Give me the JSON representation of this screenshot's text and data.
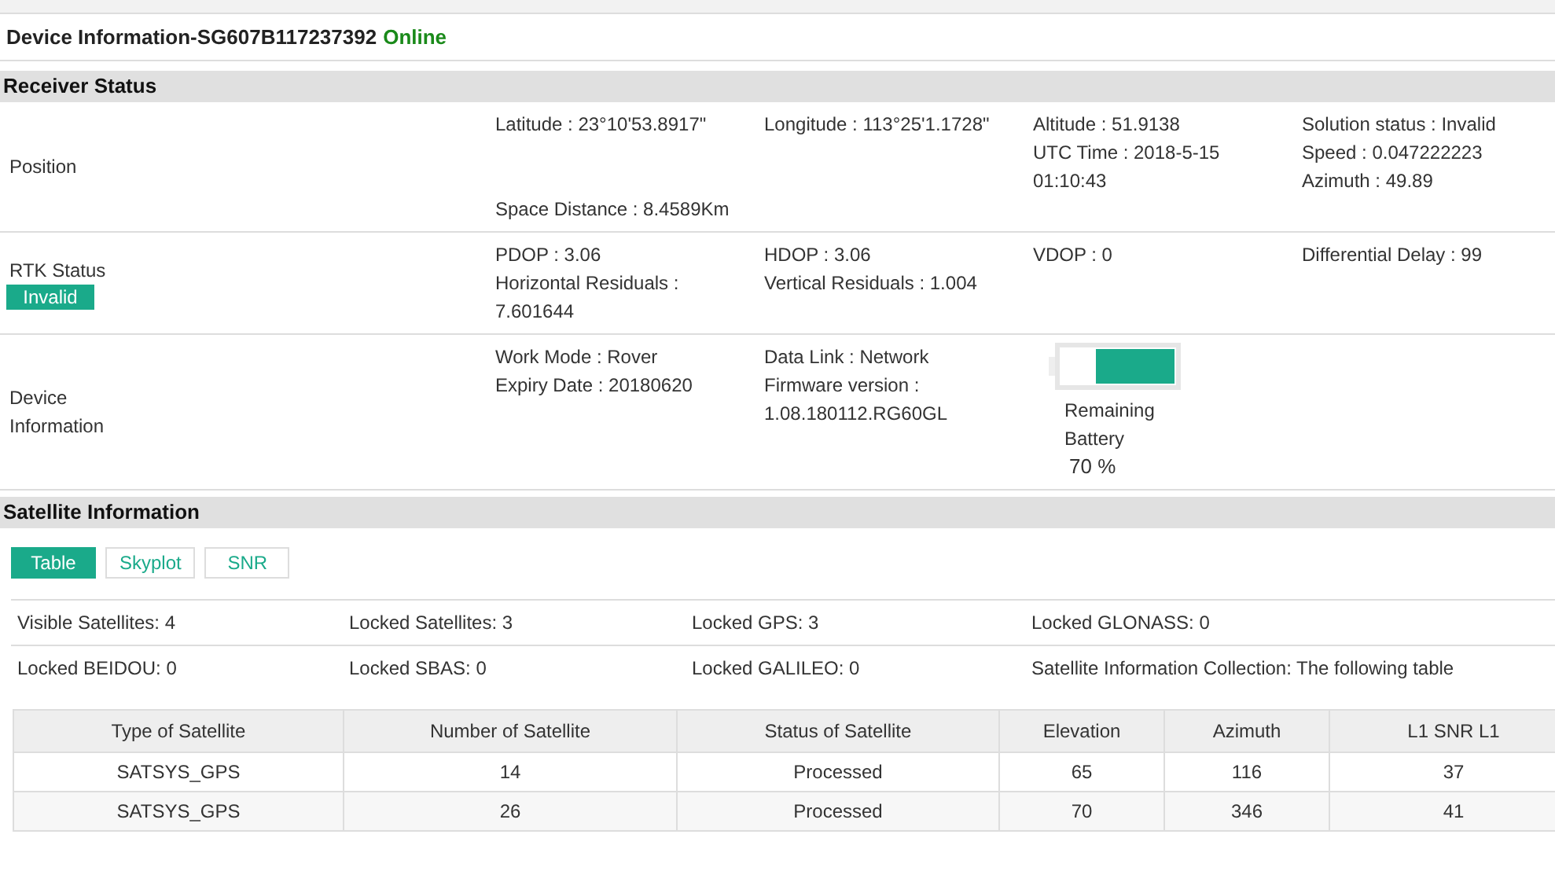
{
  "header": {
    "title": "Device Information-SG607B117237392",
    "status": "Online"
  },
  "receiver_status": {
    "title": "Receiver Status",
    "rows": [
      {
        "label": "Position",
        "cells": [
          [
            "Latitude : 23°10'53.8917\""
          ],
          [
            "Longitude : 113°25'1.1728\""
          ],
          [
            "Altitude : 51.9138",
            "UTC Time : 2018-5-15 01:10:43"
          ],
          [
            "Solution status : Invalid",
            "Speed : 0.047222223",
            "Azimuth : 49.89"
          ],
          [
            "Space Distance : 8.4589Km"
          ]
        ]
      },
      {
        "label": "RTK Status",
        "badge": "Invalid",
        "cells": [
          [
            "PDOP : 3.06",
            "Horizontal Residuals : 7.601644"
          ],
          [
            "HDOP : 3.06",
            "Vertical Residuals : 1.004"
          ],
          [
            "VDOP : 0"
          ],
          [
            "Differential Delay : 99"
          ]
        ]
      },
      {
        "label": "Device Information",
        "cells": [
          [
            "Work Mode : Rover",
            "Expiry Date : 20180620"
          ],
          [
            "Data Link : Network",
            "Firmware version : 1.08.180112.RG60GL"
          ]
        ],
        "battery": {
          "level": 0.7,
          "label": "Remaining Battery",
          "reading": "70 %"
        }
      }
    ]
  },
  "satellite_information": {
    "title": "Satellite Information",
    "tabs": [
      {
        "label": "Table",
        "selected": true
      },
      {
        "label": "Skyplot",
        "selected": false
      },
      {
        "label": "SNR",
        "selected": false
      }
    ],
    "stats": [
      [
        "Visible Satellites: 4",
        "Locked Satellites: 3",
        "Locked GPS: 3",
        "Locked GLONASS: 0"
      ],
      [
        "Locked BEIDOU: 0",
        "Locked SBAS: 0",
        "Locked GALILEO: 0",
        "Satellite Information Collection: The following table"
      ]
    ],
    "table": {
      "columns": [
        "Type of Satellite",
        "Number of Satellite",
        "Status of Satellite",
        "Elevation",
        "Azimuth",
        "L1 SNR L1"
      ],
      "rows": [
        [
          "SATSYS_GPS",
          "14",
          "Processed",
          "65",
          "116",
          "37"
        ],
        [
          "SATSYS_GPS",
          "26",
          "Processed",
          "70",
          "346",
          "41"
        ]
      ]
    }
  }
}
